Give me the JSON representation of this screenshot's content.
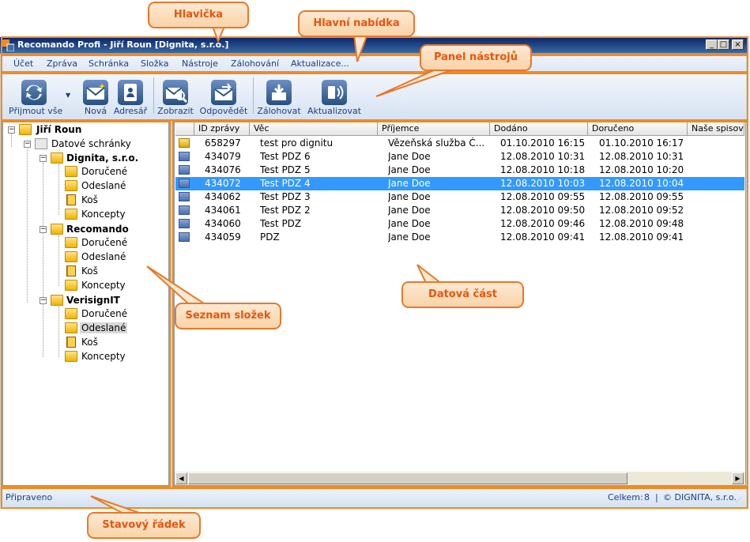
{
  "window": {
    "title": "Recomando Profi - Jiří Roun [Dignita, s.r.o.]",
    "controls": [
      "_",
      "□",
      "×"
    ]
  },
  "menu": [
    "Účet",
    "Zpráva",
    "Schránka",
    "Složka",
    "Nástroje",
    "Zálohování",
    "Aktualizace..."
  ],
  "toolbar": {
    "receive_all": "Přijmout vše",
    "new": "Nová",
    "address_book": "Adresář",
    "show": "Zobrazit",
    "reply": "Odpovědět",
    "backup": "Zálohovat",
    "update": "Aktualizovat"
  },
  "tree": {
    "root": "Jiří Roun",
    "mailboxes": "Datové schránky",
    "accounts": [
      {
        "name": "Dignita, s.r.o.",
        "folders": [
          "Doručené",
          "Odeslané",
          "Koš",
          "Koncepty"
        ]
      },
      {
        "name": "Recomando",
        "folders": [
          "Doručené",
          "Odeslané",
          "Koš",
          "Koncepty"
        ]
      },
      {
        "name": "VerisignIT",
        "folders": [
          "Doručené",
          "Odeslané",
          "Koš",
          "Koncepty"
        ]
      }
    ]
  },
  "grid": {
    "columns": [
      "ID zprávy",
      "Věc",
      "Příjemce",
      "Dodáno",
      "Doručeno",
      "Naše spisová"
    ],
    "rows": [
      {
        "id": "658297",
        "subject": "test pro dignitu",
        "recipient": "Vězeňská služba Č...",
        "delivered": "01.10.2010 16:15",
        "received": "01.10.2010 16:17",
        "type": "package"
      },
      {
        "id": "434079",
        "subject": "Test PDZ 6",
        "recipient": "Jane Doe",
        "delivered": "12.08.2010 10:31",
        "received": "12.08.2010 10:31",
        "type": "message"
      },
      {
        "id": "434076",
        "subject": "Test PDZ 5",
        "recipient": "Jane Doe",
        "delivered": "12.08.2010 10:18",
        "received": "12.08.2010 10:20",
        "type": "message"
      },
      {
        "id": "434072",
        "subject": "Test PDZ 4",
        "recipient": "Jane Doe",
        "delivered": "12.08.2010 10:03",
        "received": "12.08.2010 10:04",
        "type": "message",
        "selected": true
      },
      {
        "id": "434062",
        "subject": "Test PDZ 3",
        "recipient": "Jane Doe",
        "delivered": "12.08.2010 09:55",
        "received": "12.08.2010 09:55",
        "type": "message"
      },
      {
        "id": "434061",
        "subject": "Test PDZ 2",
        "recipient": "Jane Doe",
        "delivered": "12.08.2010 09:50",
        "received": "12.08.2010 09:52",
        "type": "message"
      },
      {
        "id": "434060",
        "subject": "Test PDZ",
        "recipient": "Jane Doe",
        "delivered": "12.08.2010 09:46",
        "received": "12.08.2010 09:48",
        "type": "message"
      },
      {
        "id": "434059",
        "subject": "PDZ",
        "recipient": "Jane Doe",
        "delivered": "12.08.2010 09:41",
        "received": "12.08.2010 09:41",
        "type": "message"
      }
    ]
  },
  "status": {
    "left": "Připraveno",
    "count_label": "Celkem:",
    "count": "8",
    "separator": "|",
    "copyright": "© DIGNITA, s.r.o."
  },
  "callouts": {
    "header": "Hlavička",
    "main_menu": "Hlavní nabídka",
    "toolbar_panel": "Panel nástrojů",
    "folder_list": "Seznam složek",
    "data_part": "Datová část",
    "status_bar": "Stavový řádek"
  },
  "colors": {
    "accent": "#f08a24",
    "callout_text": "#e8550e",
    "selection": "#3399ff",
    "title_bar": "#0a246a"
  }
}
